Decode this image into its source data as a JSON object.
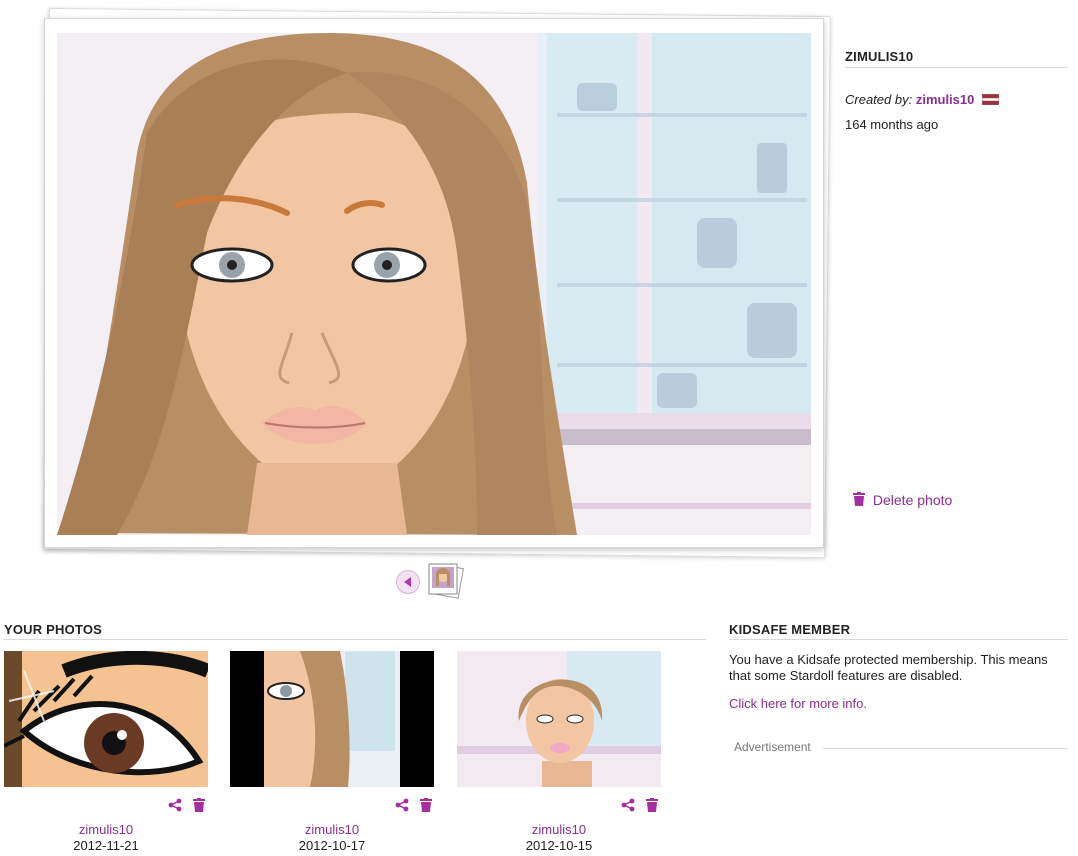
{
  "photo_panel": {
    "owner_name": "ZIMULIS10",
    "created_by_label": "Created by:",
    "creator": "zimulis10",
    "age": "164 months ago",
    "delete_label": "Delete photo"
  },
  "your_photos": {
    "title": "YOUR PHOTOS",
    "items": [
      {
        "user": "zimulis10",
        "date": "2012-11-21"
      },
      {
        "user": "zimulis10",
        "date": "2012-10-17"
      },
      {
        "user": "zimulis10",
        "date": "2012-10-15"
      }
    ]
  },
  "kidsafe": {
    "title": "KIDSAFE MEMBER",
    "text": "You have a Kidsafe protected membership. This means that some Stardoll features are disabled.",
    "link": "Click here for more info.",
    "ad_label": "Advertisement"
  },
  "colors": {
    "accent": "#8a2e91",
    "icon": "#a62ea0"
  },
  "icons": [
    "flag-icon",
    "trash-icon",
    "share-icon",
    "prev-arrow-icon",
    "photo-stack-icon"
  ]
}
